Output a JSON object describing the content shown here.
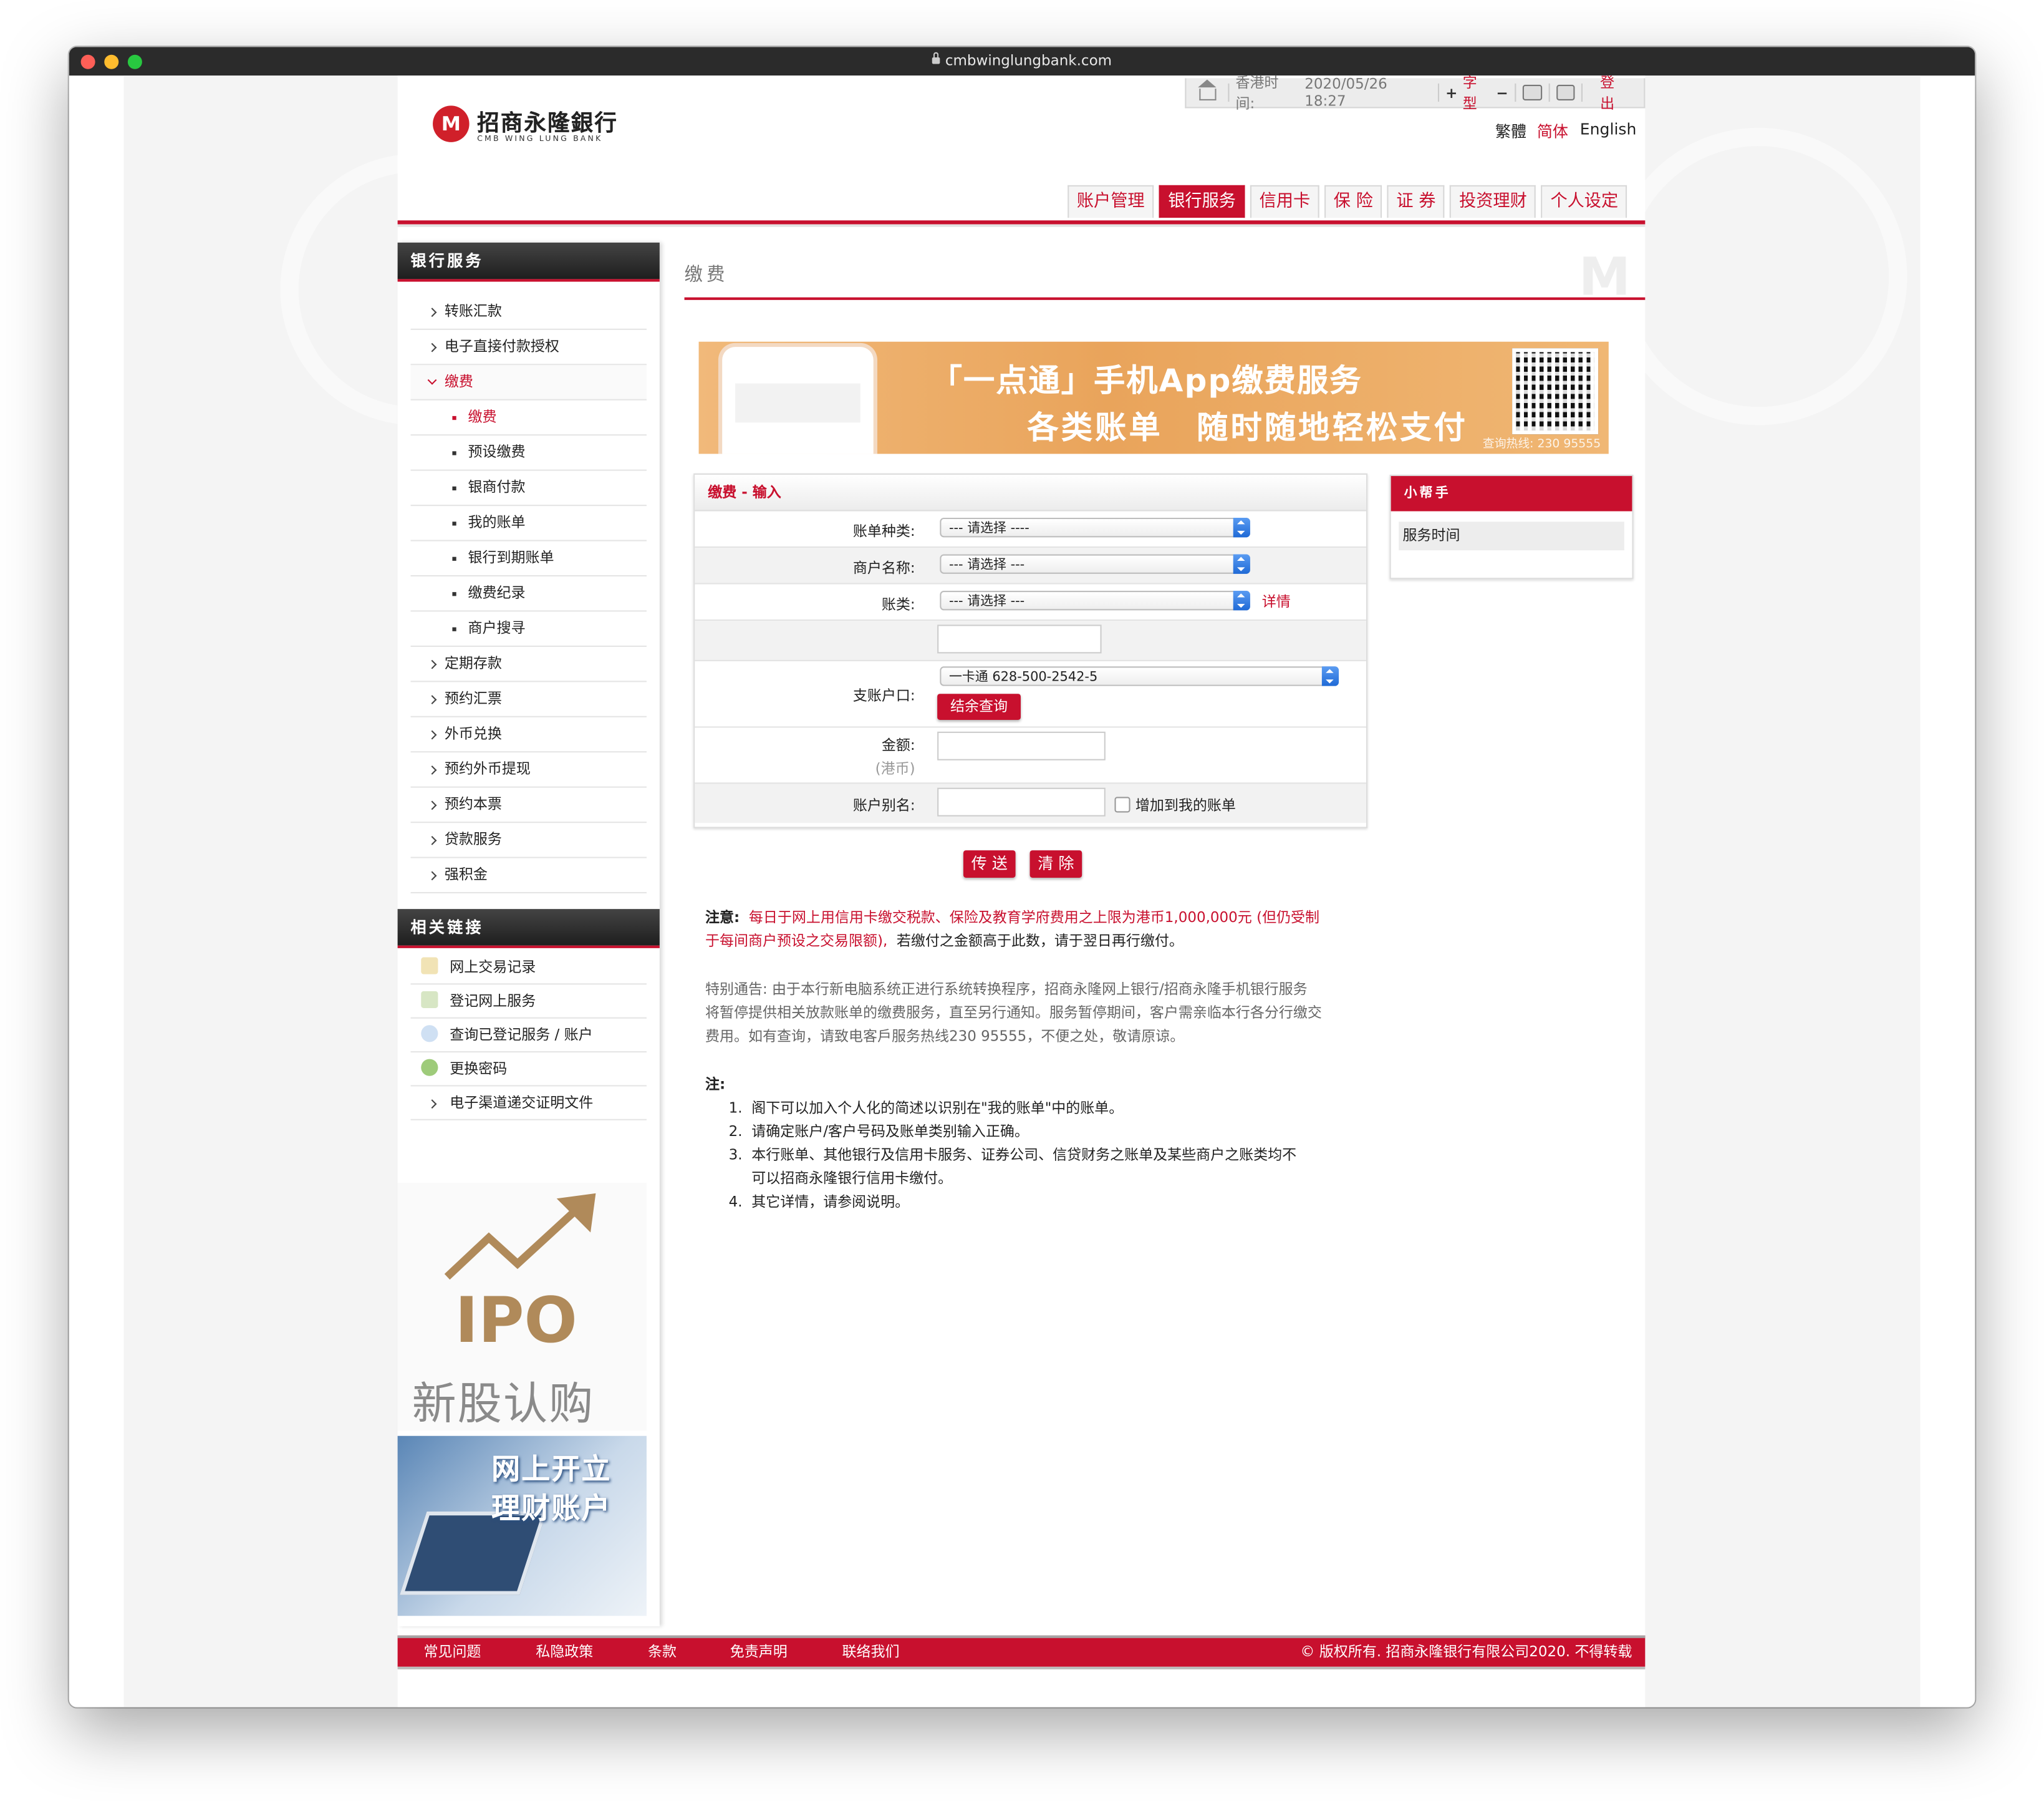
{
  "browser": {
    "url": "cmbwinglungbank.com"
  },
  "logo": {
    "mark": "M",
    "name_cn": "招商永隆銀行",
    "name_en": "CMB WING LUNG BANK"
  },
  "topbar": {
    "time_label": "香港时间:",
    "time_value": "2020/05/26 18:27",
    "font_label": "字型",
    "plus": "+",
    "minus": "−",
    "logout": "登出"
  },
  "languages": {
    "traditional": "繁體",
    "simplified": "简体",
    "english": "English"
  },
  "tabs": [
    {
      "label": "账户管理"
    },
    {
      "label": "银行服务"
    },
    {
      "label": "信用卡"
    },
    {
      "label": "保 险"
    },
    {
      "label": "证 券"
    },
    {
      "label": "投资理财"
    },
    {
      "label": "个人设定"
    }
  ],
  "sidebar": {
    "title": "银行服务",
    "items": [
      {
        "label": "转账汇款"
      },
      {
        "label": "电子直接付款授权"
      },
      {
        "label": "缴费"
      },
      {
        "label": "缴费"
      },
      {
        "label": "预设缴费"
      },
      {
        "label": "银商付款"
      },
      {
        "label": "我的账单"
      },
      {
        "label": "银行到期账单"
      },
      {
        "label": "缴费纪录"
      },
      {
        "label": "商户搜寻"
      },
      {
        "label": "定期存款"
      },
      {
        "label": "预约汇票"
      },
      {
        "label": "外币兑换"
      },
      {
        "label": "预约外币提现"
      },
      {
        "label": "预约本票"
      },
      {
        "label": "贷款服务"
      },
      {
        "label": "强积金"
      }
    ],
    "links_title": "相关链接",
    "links": [
      {
        "label": "网上交易记录"
      },
      {
        "label": "登记网上服务"
      },
      {
        "label": "查询已登记服务 / 账户"
      },
      {
        "label": "更换密码"
      },
      {
        "label": "电子渠道递交证明文件"
      }
    ],
    "ipo": {
      "text": "IPO",
      "cn": "新股认购"
    },
    "open_account": {
      "line1": "网上开立",
      "line2": "理财账户"
    }
  },
  "content": {
    "title": "缴费",
    "watermark": "M",
    "banner": {
      "line1": "「一点通」手机App缴费服务",
      "line2": "各类账单　随时随地轻松支付",
      "hotline": "查询热线: 230 95555"
    },
    "form": {
      "title": "缴费 - 输入",
      "bill_type_label": "账单种类:",
      "bill_type_value": "--- 请选择 ----",
      "merchant_label": "商户名称:",
      "merchant_value": "--- 请选择 ---",
      "bill_category_label": "账类:",
      "bill_category_value": "--- 请选择 ---",
      "details_link": "详情",
      "debit_label": "支账户口:",
      "debit_value": "一卡通 628-500-2542-5",
      "balance_button": "结余查询",
      "amount_label": "金额:",
      "amount_currency": "(港币)",
      "alias_label": "账户别名:",
      "add_to_bills": "增加到我的账单"
    },
    "buttons": {
      "send": "传 送",
      "clear": "清 除"
    },
    "helper": {
      "title": "小帮手",
      "item": "服务时间"
    },
    "notice": {
      "label": "注意:",
      "red_text_1": "每日于网上用信用卡缴交税款、保险及教育学府费用之上限为港币1,000,000元 (但仍受制",
      "red_text_2": "于每间商户预设之交易限额),",
      "black_text": "若缴付之金额高于此数，请于翌日再行缴付。"
    },
    "special": [
      "特别通告: 由于本行新电脑系统正进行系统转换程序，招商永隆网上银行/招商永隆手机银行服务",
      "将暂停提供相关放款账单的缴费服务，直至另行通知。服务暂停期间，客户需亲临本行各分行缴交",
      "费用。如有查询，请致电客戶服务热线230 95555，不便之处，敬请原谅。"
    ],
    "notes_title": "注:",
    "notes": [
      "1.  阁下可以加入个人化的简述以识别在\"我的账单\"中的账单。",
      "2.  请确定账户/客户号码及账单类别输入正确。",
      "3.  本行账单、其他银行及信用卡服务、证券公司、信贷财务之账单及某些商户之账类均不",
      "     可以招商永隆银行信用卡缴付。",
      "4.  其它详情，请参阅说明。"
    ]
  },
  "footer": {
    "links": [
      {
        "label": "常见问题"
      },
      {
        "label": "私隐政策"
      },
      {
        "label": "条款"
      },
      {
        "label": "免责声明"
      },
      {
        "label": "联络我们"
      }
    ],
    "copyright": "© 版权所有. 招商永隆银行有限公司2020. 不得转载"
  },
  "colors": {
    "brand_red": "#c8102e"
  }
}
